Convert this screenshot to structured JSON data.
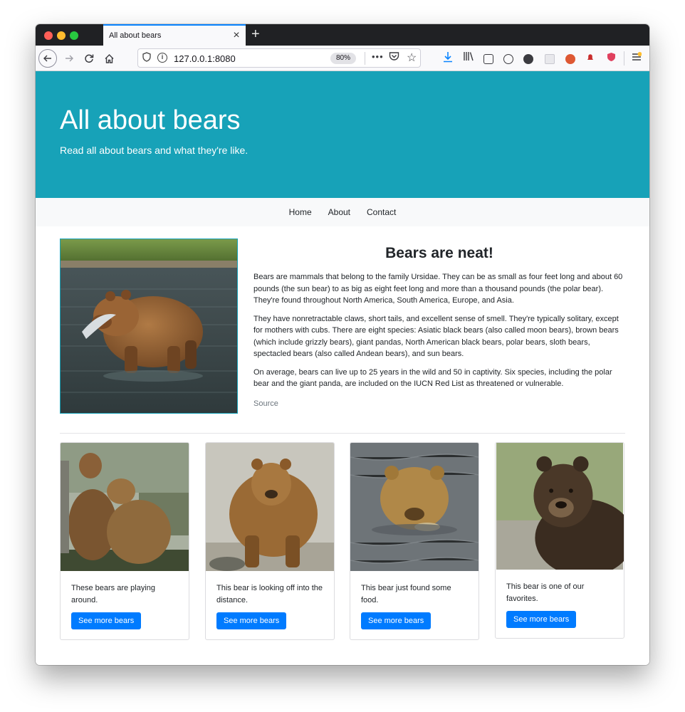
{
  "browser": {
    "tab_title": "All about bears",
    "tab_close": "×",
    "new_tab": "+",
    "url": "127.0.0.1:8080",
    "zoom": "80%",
    "more_actions": "•••"
  },
  "hero": {
    "title": "All about bears",
    "subtitle": "Read all about bears and what they're like."
  },
  "nav": {
    "items": [
      "Home",
      "About",
      "Contact"
    ]
  },
  "feature": {
    "heading": "Bears are neat!",
    "paragraphs": [
      "Bears are mammals that belong to the family Ursidae. They can be as small as four feet long and about 60 pounds (the sun bear) to as big as eight feet long and more than a thousand pounds (the polar bear). They're found throughout North America, South America, Europe, and Asia.",
      "They have nonretractable claws, short tails, and excellent sense of smell. They're typically solitary, except for mothers with cubs. There are eight species: Asiatic black bears (also called moon bears), brown bears (which include grizzly bears), giant pandas, North American black bears, polar bears, sloth bears, spectacled bears (also called Andean bears), and sun bears.",
      "On average, bears can live up to 25 years in the wild and 50 in captivity. Six species, including the polar bear and the giant panda, are included on the IUCN Red List as threatened or vulnerable."
    ],
    "source_label": "Source"
  },
  "cards": [
    {
      "text": "These bears are playing around.",
      "button": "See more bears"
    },
    {
      "text": "This bear is looking off into the distance.",
      "button": "See more bears"
    },
    {
      "text": "This bear just found some food.",
      "button": "See more bears"
    },
    {
      "text": "This bear is one of our favorites.",
      "button": "See more bears"
    }
  ],
  "colors": {
    "hero_bg": "#17a2b8",
    "button_bg": "#007bff",
    "nav_bg": "#f8f9fa"
  }
}
